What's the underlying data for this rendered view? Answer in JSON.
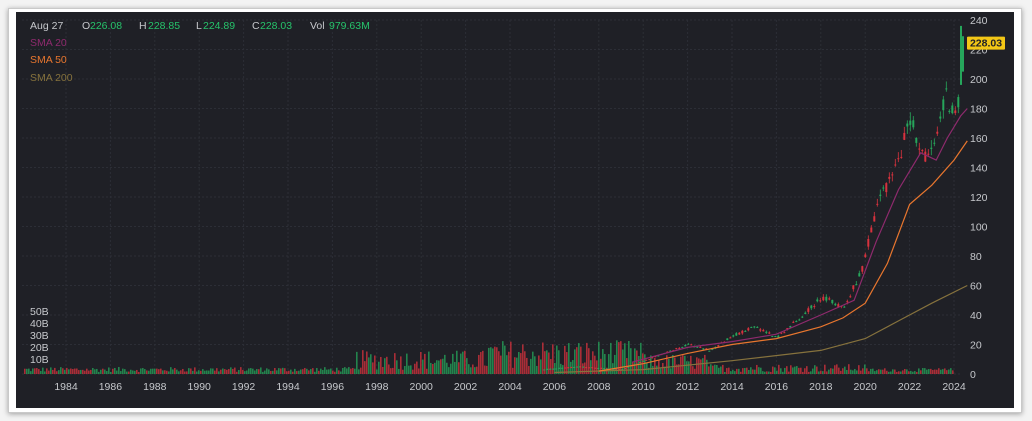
{
  "legend": {
    "date": "Aug 27",
    "open_label": "O",
    "open": "226.08",
    "high_label": "H",
    "high": "228.85",
    "low_label": "L",
    "low": "224.89",
    "close_label": "C",
    "close": "228.03",
    "vol_label": "Vol",
    "vol": "979.63M",
    "sma20": "SMA 20",
    "sma50": "SMA 50",
    "sma200": "SMA 200"
  },
  "last_price_label": "228.03",
  "colors": {
    "background": "#1f2026",
    "grid": "#2c2e36",
    "up": "#26a65b",
    "down": "#d8323e",
    "sma20": "#8e2a6d",
    "sma50": "#e8762e",
    "sma200": "#86723d",
    "price_badge": "#f3c716",
    "axis_text": "#c6c8cc",
    "value_green": "#26c36b"
  },
  "chart_data": {
    "type": "candlestick",
    "x_axis": {
      "ticks": [
        "1984",
        "1986",
        "1988",
        "1990",
        "1992",
        "1994",
        "1996",
        "1998",
        "2000",
        "2002",
        "2004",
        "2006",
        "2008",
        "2010",
        "2012",
        "2014",
        "2016",
        "2018",
        "2020",
        "2022",
        "2024"
      ],
      "range": [
        1982.6,
        2024.8
      ]
    },
    "y_axis": {
      "side": "right",
      "ticks": [
        "240",
        "220",
        "200",
        "180",
        "160",
        "140",
        "120",
        "100",
        "80",
        "60",
        "40",
        "20",
        "0"
      ],
      "range": [
        0,
        240
      ]
    },
    "volume_axis": {
      "side": "left",
      "ticks": [
        "50B",
        "40B",
        "30B",
        "20B",
        "10B"
      ]
    },
    "series": [
      {
        "name": "SMA 20",
        "points": [
          [
            2009.5,
            8
          ],
          [
            2012,
            18
          ],
          [
            2014,
            22
          ],
          [
            2016,
            27
          ],
          [
            2018,
            40
          ],
          [
            2019.5,
            50
          ],
          [
            2020.5,
            90
          ],
          [
            2021.5,
            125
          ],
          [
            2022.5,
            150
          ],
          [
            2023.2,
            145
          ],
          [
            2023.7,
            160
          ],
          [
            2024.3,
            175
          ],
          [
            2024.6,
            180
          ]
        ]
      },
      {
        "name": "SMA 50",
        "points": [
          [
            2008,
            2
          ],
          [
            2010,
            7
          ],
          [
            2012,
            14
          ],
          [
            2014,
            20
          ],
          [
            2016,
            24
          ],
          [
            2018,
            32
          ],
          [
            2019,
            38
          ],
          [
            2020,
            48
          ],
          [
            2021,
            75
          ],
          [
            2022,
            115
          ],
          [
            2023,
            128
          ],
          [
            2024,
            145
          ],
          [
            2024.6,
            158
          ]
        ]
      },
      {
        "name": "SMA 200",
        "points": [
          [
            2006,
            1
          ],
          [
            2010,
            3
          ],
          [
            2014,
            9
          ],
          [
            2018,
            16
          ],
          [
            2020,
            24
          ],
          [
            2021.5,
            36
          ],
          [
            2023,
            48
          ],
          [
            2024.6,
            60
          ]
        ]
      }
    ],
    "price_points": [
      [
        1982.6,
        0.1
      ],
      [
        2000,
        1
      ],
      [
        2004,
        1
      ],
      [
        2007,
        5
      ],
      [
        2009,
        3
      ],
      [
        2010,
        9
      ],
      [
        2012,
        20
      ],
      [
        2013,
        16
      ],
      [
        2014,
        26
      ],
      [
        2015,
        32
      ],
      [
        2016,
        25
      ],
      [
        2017,
        38
      ],
      [
        2018,
        52
      ],
      [
        2019,
        45
      ],
      [
        2019.8,
        70
      ],
      [
        2020.6,
        120
      ],
      [
        2021,
        130
      ],
      [
        2021.5,
        145
      ],
      [
        2022,
        175
      ],
      [
        2022.6,
        145
      ],
      [
        2023,
        150
      ],
      [
        2023.6,
        190
      ],
      [
        2024.0,
        175
      ],
      [
        2024.3,
        190
      ],
      [
        2024.5,
        215
      ],
      [
        2024.65,
        228
      ]
    ],
    "last_price": 228.03
  }
}
